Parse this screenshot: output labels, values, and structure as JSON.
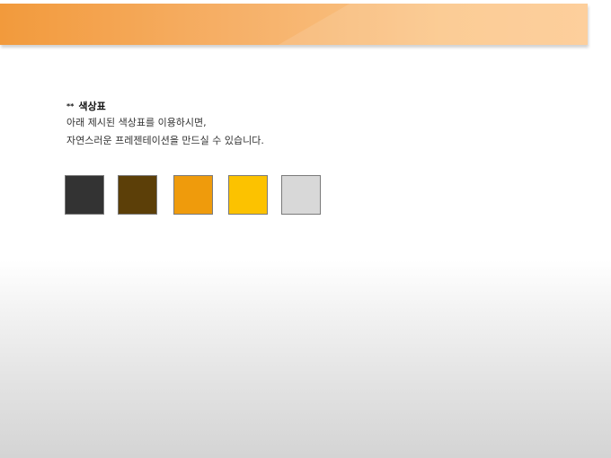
{
  "header": {
    "accent_color": "#f6b068"
  },
  "section": {
    "mark": "**",
    "title": "색상표",
    "description_lines": [
      "아래 제시된 색상표를 이용하시면,",
      "자연스러운 프레젠테이션을 만드실 수 있습니다."
    ]
  },
  "palette": [
    {
      "name": "dark-gray",
      "color": "#333333"
    },
    {
      "name": "dark-brown",
      "color": "#5c3f08"
    },
    {
      "name": "orange",
      "color": "#ef9b0c"
    },
    {
      "name": "golden-yellow",
      "color": "#fcc200"
    },
    {
      "name": "light-gray",
      "color": "#d8d8d8"
    }
  ]
}
